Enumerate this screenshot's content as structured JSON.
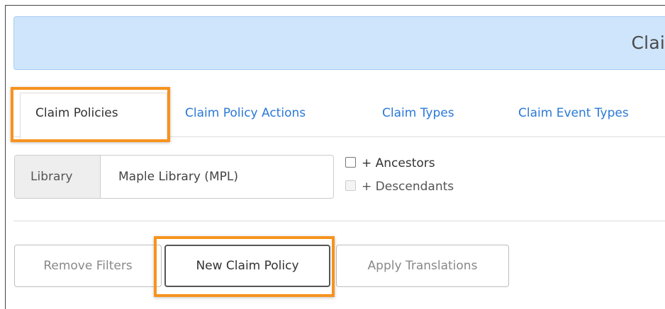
{
  "banner": {
    "title": "Clai"
  },
  "tabs": [
    {
      "label": "Claim Policies",
      "active": true
    },
    {
      "label": "Claim Policy Actions",
      "active": false
    },
    {
      "label": "Claim Types",
      "active": false
    },
    {
      "label": "Claim Event Types",
      "active": false
    }
  ],
  "filter": {
    "addon_label": "Library",
    "value": "Maple Library (MPL)",
    "ancestors_label": "+ Ancestors",
    "ancestors_checked": false,
    "descendants_label": "+ Descendants",
    "descendants_enabled": false
  },
  "buttons": {
    "remove_filters": "Remove Filters",
    "new_claim_policy": "New Claim Policy",
    "apply_translations": "Apply Translations"
  },
  "colors": {
    "highlight": "#f7931e",
    "banner": "#cfe5fb",
    "link": "#2a78d6"
  }
}
